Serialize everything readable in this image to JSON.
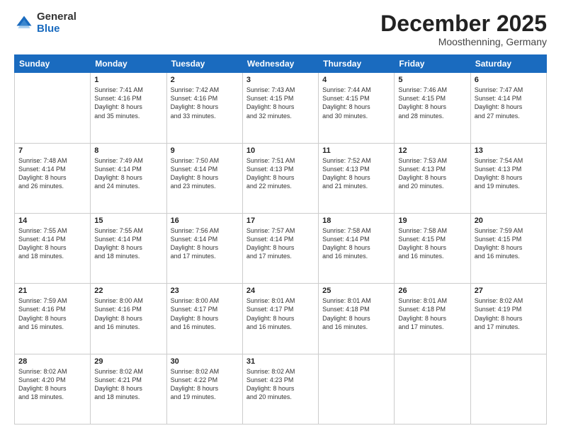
{
  "logo": {
    "general": "General",
    "blue": "Blue"
  },
  "header": {
    "month": "December 2025",
    "location": "Moosthenning, Germany"
  },
  "weekdays": [
    "Sunday",
    "Monday",
    "Tuesday",
    "Wednesday",
    "Thursday",
    "Friday",
    "Saturday"
  ],
  "weeks": [
    [
      {
        "day": "",
        "info": ""
      },
      {
        "day": "1",
        "info": "Sunrise: 7:41 AM\nSunset: 4:16 PM\nDaylight: 8 hours\nand 35 minutes."
      },
      {
        "day": "2",
        "info": "Sunrise: 7:42 AM\nSunset: 4:16 PM\nDaylight: 8 hours\nand 33 minutes."
      },
      {
        "day": "3",
        "info": "Sunrise: 7:43 AM\nSunset: 4:15 PM\nDaylight: 8 hours\nand 32 minutes."
      },
      {
        "day": "4",
        "info": "Sunrise: 7:44 AM\nSunset: 4:15 PM\nDaylight: 8 hours\nand 30 minutes."
      },
      {
        "day": "5",
        "info": "Sunrise: 7:46 AM\nSunset: 4:15 PM\nDaylight: 8 hours\nand 28 minutes."
      },
      {
        "day": "6",
        "info": "Sunrise: 7:47 AM\nSunset: 4:14 PM\nDaylight: 8 hours\nand 27 minutes."
      }
    ],
    [
      {
        "day": "7",
        "info": "Sunrise: 7:48 AM\nSunset: 4:14 PM\nDaylight: 8 hours\nand 26 minutes."
      },
      {
        "day": "8",
        "info": "Sunrise: 7:49 AM\nSunset: 4:14 PM\nDaylight: 8 hours\nand 24 minutes."
      },
      {
        "day": "9",
        "info": "Sunrise: 7:50 AM\nSunset: 4:14 PM\nDaylight: 8 hours\nand 23 minutes."
      },
      {
        "day": "10",
        "info": "Sunrise: 7:51 AM\nSunset: 4:13 PM\nDaylight: 8 hours\nand 22 minutes."
      },
      {
        "day": "11",
        "info": "Sunrise: 7:52 AM\nSunset: 4:13 PM\nDaylight: 8 hours\nand 21 minutes."
      },
      {
        "day": "12",
        "info": "Sunrise: 7:53 AM\nSunset: 4:13 PM\nDaylight: 8 hours\nand 20 minutes."
      },
      {
        "day": "13",
        "info": "Sunrise: 7:54 AM\nSunset: 4:13 PM\nDaylight: 8 hours\nand 19 minutes."
      }
    ],
    [
      {
        "day": "14",
        "info": "Sunrise: 7:55 AM\nSunset: 4:14 PM\nDaylight: 8 hours\nand 18 minutes."
      },
      {
        "day": "15",
        "info": "Sunrise: 7:55 AM\nSunset: 4:14 PM\nDaylight: 8 hours\nand 18 minutes."
      },
      {
        "day": "16",
        "info": "Sunrise: 7:56 AM\nSunset: 4:14 PM\nDaylight: 8 hours\nand 17 minutes."
      },
      {
        "day": "17",
        "info": "Sunrise: 7:57 AM\nSunset: 4:14 PM\nDaylight: 8 hours\nand 17 minutes."
      },
      {
        "day": "18",
        "info": "Sunrise: 7:58 AM\nSunset: 4:14 PM\nDaylight: 8 hours\nand 16 minutes."
      },
      {
        "day": "19",
        "info": "Sunrise: 7:58 AM\nSunset: 4:15 PM\nDaylight: 8 hours\nand 16 minutes."
      },
      {
        "day": "20",
        "info": "Sunrise: 7:59 AM\nSunset: 4:15 PM\nDaylight: 8 hours\nand 16 minutes."
      }
    ],
    [
      {
        "day": "21",
        "info": "Sunrise: 7:59 AM\nSunset: 4:16 PM\nDaylight: 8 hours\nand 16 minutes."
      },
      {
        "day": "22",
        "info": "Sunrise: 8:00 AM\nSunset: 4:16 PM\nDaylight: 8 hours\nand 16 minutes."
      },
      {
        "day": "23",
        "info": "Sunrise: 8:00 AM\nSunset: 4:17 PM\nDaylight: 8 hours\nand 16 minutes."
      },
      {
        "day": "24",
        "info": "Sunrise: 8:01 AM\nSunset: 4:17 PM\nDaylight: 8 hours\nand 16 minutes."
      },
      {
        "day": "25",
        "info": "Sunrise: 8:01 AM\nSunset: 4:18 PM\nDaylight: 8 hours\nand 16 minutes."
      },
      {
        "day": "26",
        "info": "Sunrise: 8:01 AM\nSunset: 4:18 PM\nDaylight: 8 hours\nand 17 minutes."
      },
      {
        "day": "27",
        "info": "Sunrise: 8:02 AM\nSunset: 4:19 PM\nDaylight: 8 hours\nand 17 minutes."
      }
    ],
    [
      {
        "day": "28",
        "info": "Sunrise: 8:02 AM\nSunset: 4:20 PM\nDaylight: 8 hours\nand 18 minutes."
      },
      {
        "day": "29",
        "info": "Sunrise: 8:02 AM\nSunset: 4:21 PM\nDaylight: 8 hours\nand 18 minutes."
      },
      {
        "day": "30",
        "info": "Sunrise: 8:02 AM\nSunset: 4:22 PM\nDaylight: 8 hours\nand 19 minutes."
      },
      {
        "day": "31",
        "info": "Sunrise: 8:02 AM\nSunset: 4:23 PM\nDaylight: 8 hours\nand 20 minutes."
      },
      {
        "day": "",
        "info": ""
      },
      {
        "day": "",
        "info": ""
      },
      {
        "day": "",
        "info": ""
      }
    ]
  ]
}
